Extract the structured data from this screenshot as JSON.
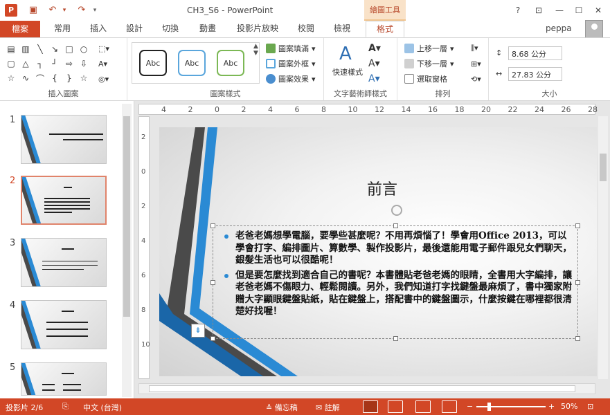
{
  "window": {
    "title": "CH3_S6 - PowerPoint",
    "context_tab": "繪圖工具"
  },
  "quick_access": {
    "save": "save",
    "undo": "undo",
    "redo": "redo"
  },
  "tabs": [
    {
      "label": "檔案"
    },
    {
      "label": "常用"
    },
    {
      "label": "插入"
    },
    {
      "label": "設計"
    },
    {
      "label": "切換"
    },
    {
      "label": "動畫"
    },
    {
      "label": "投影片放映"
    },
    {
      "label": "校閱"
    },
    {
      "label": "檢視"
    },
    {
      "label": "格式"
    }
  ],
  "user": {
    "name": "peppa"
  },
  "ribbon": {
    "groups": {
      "insert_shapes": "插入圖案",
      "shape_styles": "圖案樣式",
      "wordart": "文字藝術師樣式",
      "arrange": "排列",
      "size": "大小"
    },
    "style_sample": "Abc",
    "shape_fill": "圖案填滿",
    "shape_outline": "圖案外框",
    "shape_effects": "圖案效果",
    "quick_styles": "快速樣式",
    "bring_forward": "上移一層",
    "send_backward": "下移一層",
    "selection_pane": "選取窗格",
    "height": "8.68 公分",
    "width": "27.83 公分"
  },
  "thumbnails": [
    {
      "num": "1",
      "title": "銀髮族的快樂電腦時光：Office 2013四合一"
    },
    {
      "num": "2",
      "title": "前言"
    },
    {
      "num": "3",
      "title": "作者簡介"
    },
    {
      "num": "4",
      "title": "本書特色"
    },
    {
      "num": "5",
      "title": "本書大綱"
    }
  ],
  "ruler": {
    "h_ticks": [
      "4",
      "2",
      "0",
      "2",
      "4",
      "6",
      "8",
      "10",
      "12",
      "14",
      "16",
      "18",
      "20",
      "22",
      "24",
      "26",
      "28"
    ],
    "v_ticks": [
      "2",
      "0",
      "2",
      "4",
      "6",
      "8",
      "10"
    ]
  },
  "slide": {
    "title": "前言",
    "bullets": [
      "老爸老媽想學電腦，要學些甚麼呢？不用再煩惱了！學會用Office 2013，可以學會打字、編排圖片、算數學、製作投影片，最後還能用電子郵件跟兒女們聊天，銀髮生活也可以很酷呢！",
      "但是要怎麼找到適合自己的書呢？本書體貼老爸老媽的眼睛，全書用大字編排，讓老爸老媽不傷眼力、輕鬆閱讀。另外，我們知道打字找鍵盤最麻煩了，書中獨家附贈大字顯眼鍵盤貼紙，貼在鍵盤上，搭配書中的鍵盤圖示，什麼按鍵在哪裡都很清楚好找喔！"
    ]
  },
  "status": {
    "slide_info": "投影片 2/6",
    "language": "中文 (台灣)",
    "notes": "備忘稿",
    "comments": "註解",
    "zoom": "50%"
  },
  "colors": {
    "accent": "#D24726",
    "slide_blue": "#2A8AD4",
    "slide_dark": "#4A4A4A"
  }
}
